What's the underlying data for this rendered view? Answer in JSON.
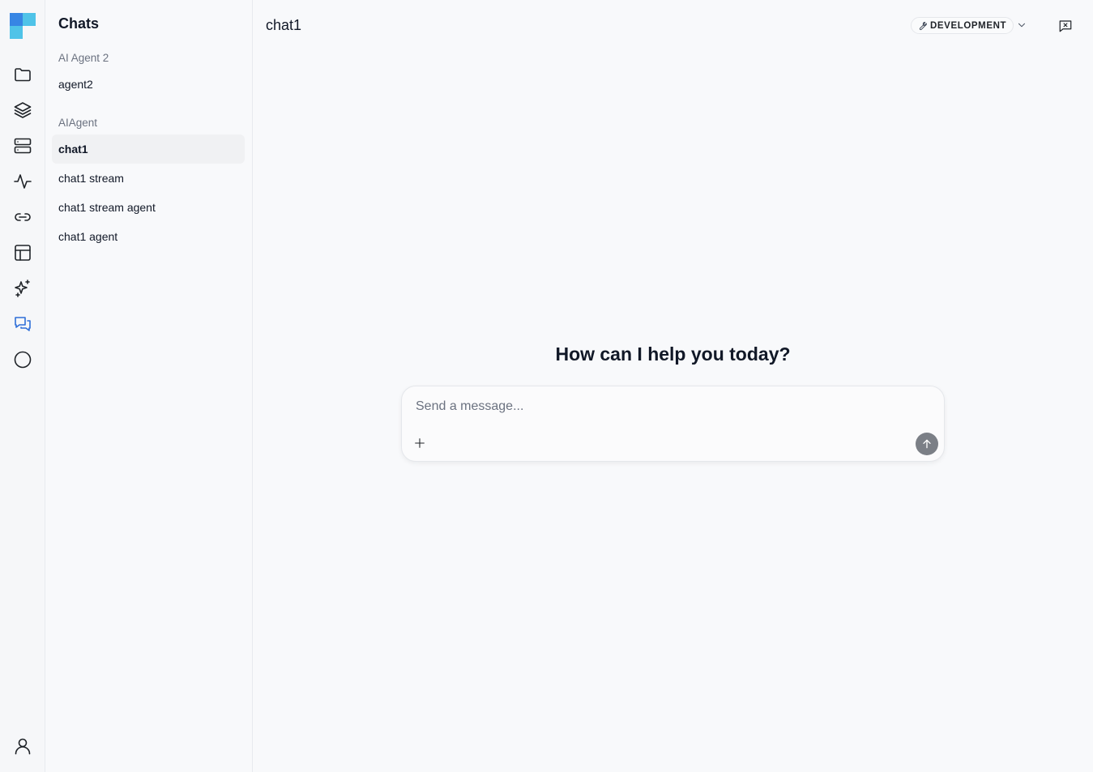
{
  "rail": {
    "icons": [
      "folder-icon",
      "layers-icon",
      "server-icon",
      "activity-icon",
      "link-icon",
      "table-icon",
      "sparkles-icon",
      "chats-icon",
      "circle-icon",
      "user-icon"
    ],
    "active": "chats-icon",
    "accent_color": "#2f6fd8"
  },
  "sidebar": {
    "title": "Chats",
    "groups": [
      {
        "label": "AI Agent 2",
        "items": [
          "agent2"
        ]
      },
      {
        "label": "AIAgent",
        "items": [
          "chat1",
          "chat1 stream",
          "chat1 stream agent",
          "chat1 agent"
        ]
      }
    ],
    "selected": "chat1"
  },
  "header": {
    "title": "chat1",
    "environment": "DEVELOPMENT"
  },
  "main": {
    "greeting": "How can I help you today?",
    "composer": {
      "placeholder": "Send a message...",
      "value": ""
    }
  }
}
